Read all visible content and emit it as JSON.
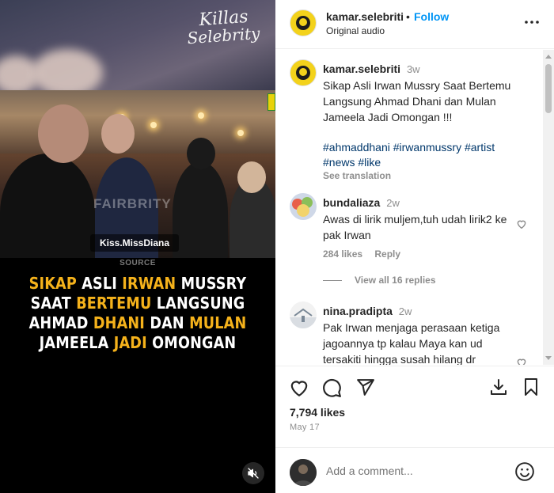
{
  "media": {
    "watermark_line1": "Killas",
    "watermark_line2": "Selebrity",
    "overlay_watermark": "FAIRBRITY",
    "credit_tag": "Kiss.MissDiana",
    "source_label": "SOURCE",
    "headline_lines": [
      [
        {
          "t": "SIKAP",
          "h": true
        },
        {
          "t": " ASLI ",
          "h": false
        },
        {
          "t": "IRWAN",
          "h": true
        },
        {
          "t": " MUSSRY",
          "h": false
        }
      ],
      [
        {
          "t": "SAAT ",
          "h": false
        },
        {
          "t": "BERTEMU",
          "h": true
        },
        {
          "t": " LANGSUNG",
          "h": false
        }
      ],
      [
        {
          "t": "AHMAD ",
          "h": false
        },
        {
          "t": "DHANI",
          "h": true
        },
        {
          "t": " DAN ",
          "h": false
        },
        {
          "t": "MULAN",
          "h": true
        }
      ],
      [
        {
          "t": "JAMEELA ",
          "h": false
        },
        {
          "t": "JADI",
          "h": true
        },
        {
          "t": " OMONGAN",
          "h": false
        }
      ]
    ]
  },
  "header": {
    "username": "kamar.selebriti",
    "separator": "•",
    "follow_label": "Follow",
    "audio_label": "Original audio",
    "more_icon": "more-horizontal-icon"
  },
  "caption": {
    "username": "kamar.selebriti",
    "time": "3w",
    "text": "Sikap Asli Irwan Mussry Saat Bertemu Langsung Ahmad Dhani dan Mulan Jameela Jadi Omongan !!!",
    "hashtags_line1": "#ahmaddhani #irwanmussry #artist",
    "hashtags_line2": "#news #like",
    "see_translation": "See translation"
  },
  "comments": [
    {
      "username": "bundaliaza",
      "time": "2w",
      "text": "Awas di lirik muljem,tuh udah lirik2 ke pak Irwan",
      "likes": "284 likes",
      "reply_label": "Reply",
      "view_replies": "View all 16 replies"
    },
    {
      "username": "nina.pradipta",
      "time": "2w",
      "text": "Pak Irwan menjaga perasaan ketiga jagoannya tp kalau Maya kan ud tersakiti hingga susah hilang dr"
    }
  ],
  "actions": {
    "likes_count": "7,794 likes",
    "date": "May 17",
    "comment_placeholder": "Add a comment..."
  },
  "colors": {
    "accent": "#0095f6",
    "headline_highlight": "#f5b21b",
    "hashtag": "#00376b",
    "muted": "#8e8e8e",
    "avatar_yellow": "#f3d21b"
  }
}
